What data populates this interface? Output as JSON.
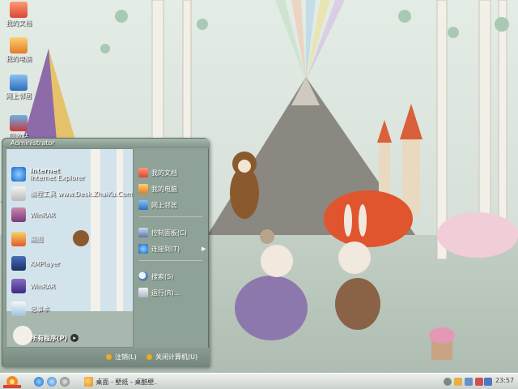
{
  "desktop": {
    "icons": [
      {
        "label": "我的文档",
        "icon": "folder-icon"
      },
      {
        "label": "我的电脑",
        "icon": "computer-icon"
      },
      {
        "label": "网上邻居",
        "icon": "network-icon"
      },
      {
        "label": "回收站",
        "icon": "recycle-bin-icon"
      }
    ]
  },
  "start_menu": {
    "user_name": "Administrator",
    "pinned": [
      {
        "title": "Internet",
        "subtitle": "Internet Explorer",
        "icon": "internet-explorer-icon"
      },
      {
        "title": "编程工具",
        "subtitle": "www.Desk.ZhaiKu.Com",
        "icon": "tool-icon"
      }
    ],
    "recent": [
      {
        "label": "WinRAR",
        "icon": "winrar-icon"
      },
      {
        "label": "画图",
        "icon": "paint-icon"
      },
      {
        "label": "KMPlayer",
        "icon": "media-player-icon"
      },
      {
        "label": "WinRAR",
        "icon": "archive-icon"
      },
      {
        "label": "记事本",
        "icon": "notepad-icon"
      }
    ],
    "all_programs": "所有程序(P)",
    "right_items": [
      {
        "label": "我的文档",
        "icon": "documents-icon"
      },
      {
        "label": "我的电脑",
        "icon": "computer-icon"
      },
      {
        "label": "网上邻居",
        "icon": "network-icon"
      },
      {
        "label": "控制面板(C)",
        "icon": "control-panel-icon"
      },
      {
        "label": "连接到(T)",
        "icon": "connect-icon",
        "has_submenu": true
      },
      {
        "label": "搜索(S)",
        "icon": "search-icon"
      },
      {
        "label": "运行(R)...",
        "icon": "run-icon"
      }
    ],
    "footer": {
      "logoff": "注销(L)",
      "shutdown": "关闭计算机(U)"
    }
  },
  "taskbar": {
    "task_label": "桌面 - 壁纸 - 桌酷壁...",
    "clock": "23:57"
  }
}
